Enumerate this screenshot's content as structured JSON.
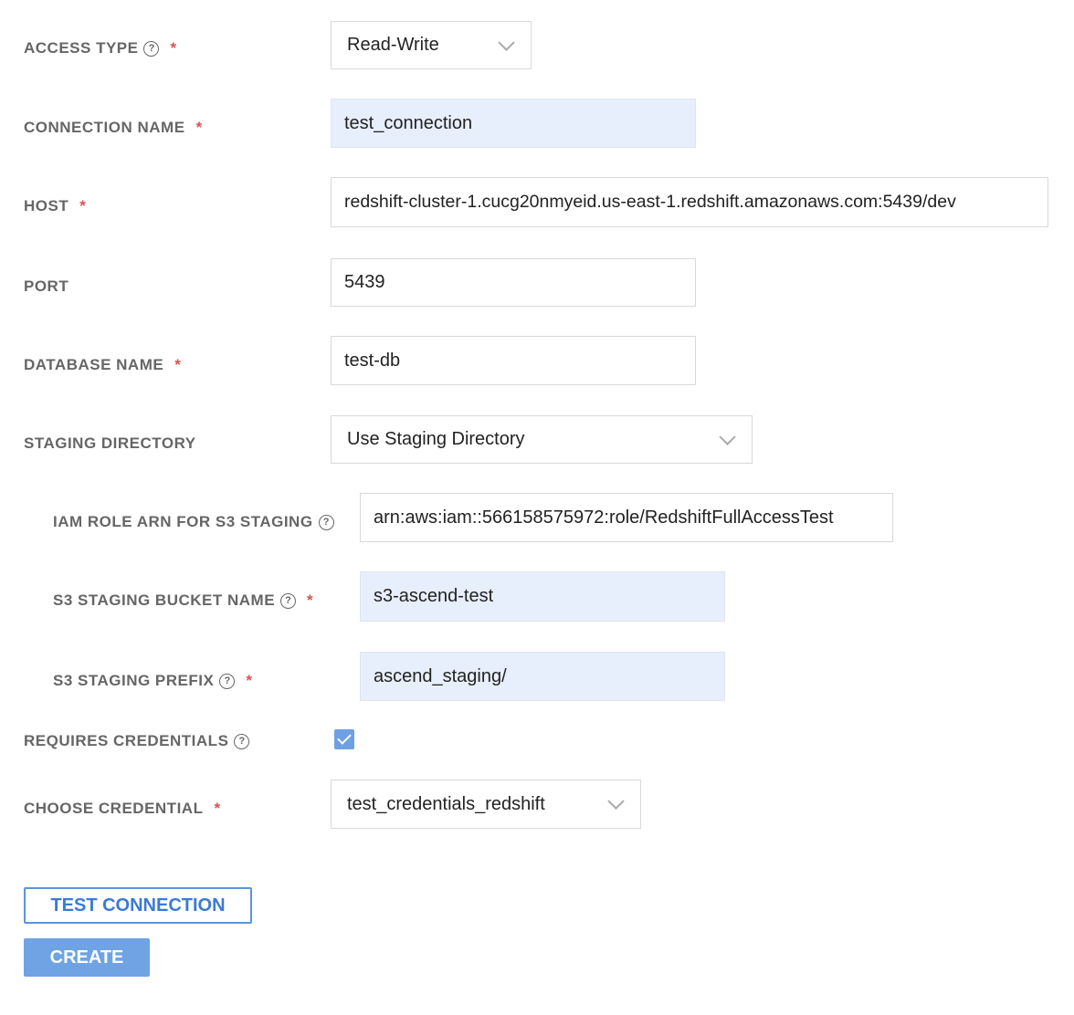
{
  "fields": {
    "access_type": {
      "label": "ACCESS TYPE",
      "value": "Read-Write",
      "help_icon": "question-circle-icon",
      "required": "*"
    },
    "connection_name": {
      "label": "CONNECTION NAME",
      "value": "test_connection",
      "required": "*"
    },
    "host": {
      "label": "HOST",
      "value": "redshift-cluster-1.cucg20nmyeid.us-east-1.redshift.amazonaws.com:5439/dev",
      "required": "*"
    },
    "port": {
      "label": "PORT",
      "value": "5439"
    },
    "database_name": {
      "label": "DATABASE NAME",
      "value": "test-db",
      "required": "*"
    },
    "staging_directory": {
      "label": "STAGING DIRECTORY",
      "value": "Use Staging Directory"
    },
    "iam_role_arn": {
      "label": "IAM ROLE ARN FOR S3 STAGING",
      "value": "arn:aws:iam::566158575972:role/RedshiftFullAccessTest",
      "help_icon": "question-circle-icon"
    },
    "s3_bucket_name": {
      "label": "S3 STAGING BUCKET NAME",
      "value": "s3-ascend-test",
      "help_icon": "question-circle-icon",
      "required": "*"
    },
    "s3_prefix": {
      "label": "S3 STAGING PREFIX",
      "value": "ascend_staging/",
      "help_icon": "question-circle-icon",
      "required": "*"
    },
    "requires_credentials": {
      "label": "REQUIRES CREDENTIALS",
      "help_icon": "question-circle-icon",
      "checked": true
    },
    "choose_credential": {
      "label": "CHOOSE CREDENTIAL",
      "value": "test_credentials_redshift",
      "required": "*"
    }
  },
  "buttons": {
    "test_connection": "TEST CONNECTION",
    "create": "CREATE"
  },
  "colors": {
    "required": "#d9534f",
    "accent": "#3a7bd5",
    "filled_input": "#e8effc"
  }
}
